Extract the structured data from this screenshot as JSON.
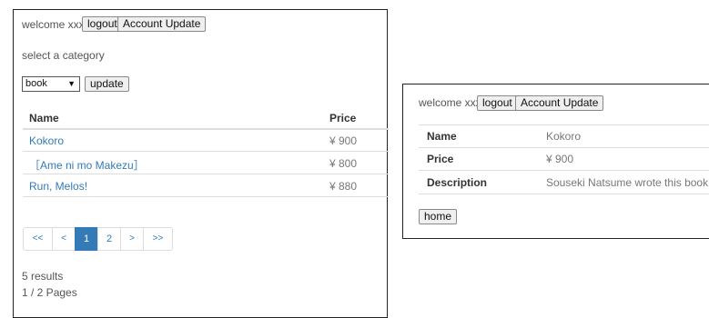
{
  "list_page": {
    "welcome": "welcome xxx",
    "logout_label": "logout",
    "account_label": "Account Update",
    "category_prompt": "select a category",
    "category_selected": "book",
    "update_label": "update",
    "columns": {
      "name": "Name",
      "price": "Price"
    },
    "rows": [
      {
        "name": "Kokoro",
        "price": "¥ 900"
      },
      {
        "name": "［Ame ni mo Makezu］",
        "price": "¥ 800"
      },
      {
        "name": "Run, Melos!",
        "price": "¥ 880"
      }
    ],
    "pagination": {
      "first": "<<",
      "prev": "<",
      "pages": [
        "1",
        "2"
      ],
      "active_page": "1",
      "next": ">",
      "last": ">>"
    },
    "results_text": "5 results",
    "pages_text": "1 / 2 Pages"
  },
  "detail_page": {
    "welcome": "welcome xxx",
    "logout_label": "logout",
    "account_label": "Account Update",
    "fields": [
      {
        "label": "Name",
        "value": "Kokoro"
      },
      {
        "label": "Price",
        "value": "¥ 900"
      },
      {
        "label": "Description",
        "value": "Souseki Natsume wrote this book"
      }
    ],
    "home_label": "home"
  },
  "colors": {
    "link": "#337ab7",
    "border": "#dddddd",
    "active_page_bg": "#337ab7"
  }
}
